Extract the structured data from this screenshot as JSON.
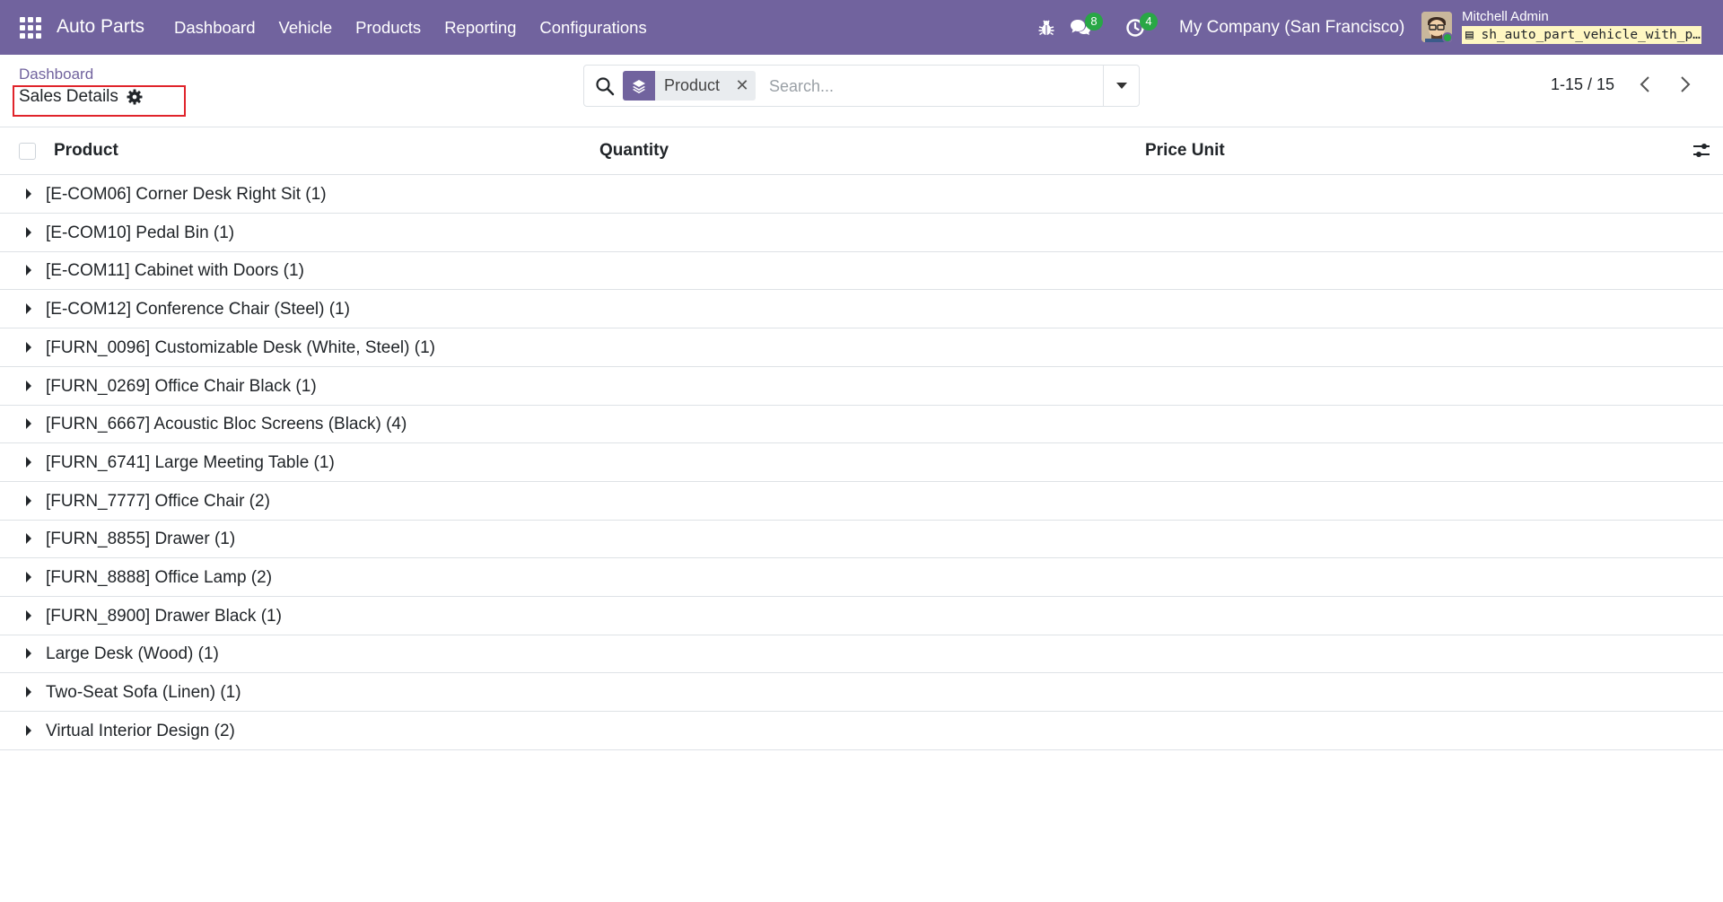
{
  "navbar": {
    "app_name": "Auto Parts",
    "menu": [
      "Dashboard",
      "Vehicle",
      "Products",
      "Reporting",
      "Configurations"
    ],
    "messages_count": "8",
    "activities_count": "4",
    "company": "My Company (San Francisco)",
    "user_name": "Mitchell Admin",
    "database": "sh_auto_part_vehicle_with_pos",
    "colors": {
      "brand": "#71639e",
      "badge": "#28a745"
    }
  },
  "control_panel": {
    "breadcrumb": "Dashboard",
    "title": "Sales Details",
    "search": {
      "facet_label": "Product",
      "placeholder": "Search...",
      "value": ""
    },
    "pager": "1-15 / 15"
  },
  "list": {
    "columns": [
      "Product",
      "Quantity",
      "Price Unit"
    ],
    "groups": [
      "[E-COM06] Corner Desk Right Sit (1)",
      "[E-COM10] Pedal Bin (1)",
      "[E-COM11] Cabinet with Doors (1)",
      "[E-COM12] Conference Chair (Steel) (1)",
      "[FURN_0096] Customizable Desk (White, Steel) (1)",
      "[FURN_0269] Office Chair Black (1)",
      "[FURN_6667] Acoustic Bloc Screens (Black) (4)",
      "[FURN_6741] Large Meeting Table (1)",
      "[FURN_7777] Office Chair (2)",
      "[FURN_8855] Drawer (1)",
      "[FURN_8888] Office Lamp (2)",
      "[FURN_8900] Drawer Black (1)",
      "Large Desk (Wood) (1)",
      "Two-Seat Sofa (Linen) (1)",
      "Virtual Interior Design (2)"
    ]
  }
}
